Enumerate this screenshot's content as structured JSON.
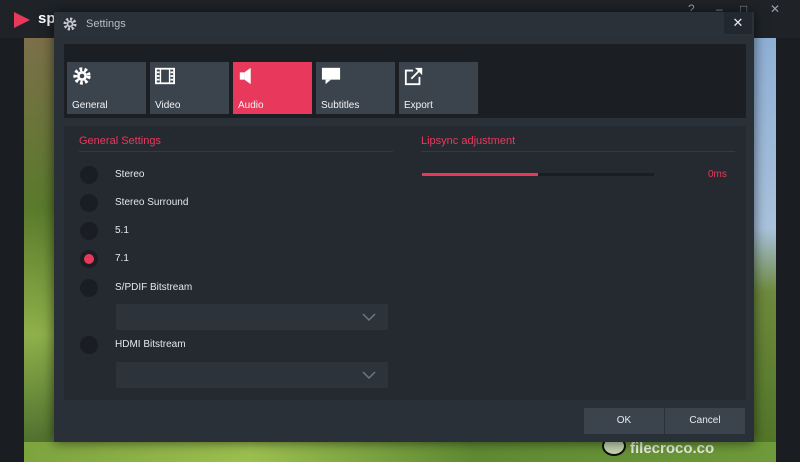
{
  "app": {
    "name": "sp"
  },
  "dialog": {
    "title": "Settings",
    "close_symbol": "✕",
    "tabs": [
      {
        "label": "General",
        "icon": "gear-icon"
      },
      {
        "label": "Video",
        "icon": "film-icon"
      },
      {
        "label": "Audio",
        "icon": "speaker-icon"
      },
      {
        "label": "Subtitles",
        "icon": "speech-bubble-icon"
      },
      {
        "label": "Export",
        "icon": "export-icon"
      }
    ],
    "active_tab": "Audio"
  },
  "general_settings": {
    "title": "General Settings",
    "options": [
      {
        "label": "Stereo",
        "checked": false
      },
      {
        "label": "Stereo Surround",
        "checked": false
      },
      {
        "label": "5.1",
        "checked": false
      },
      {
        "label": "7.1",
        "checked": true
      },
      {
        "label": "S/PDIF Bitstream",
        "checked": false
      },
      {
        "label": "HDMI Bitstream",
        "checked": false
      }
    ],
    "spdif_select_value": "",
    "hdmi_select_value": ""
  },
  "lipsync": {
    "title": "Lipsync adjustment",
    "value": "0ms",
    "slider_fraction": 0.5
  },
  "footer": {
    "ok_label": "OK",
    "cancel_label": "Cancel"
  },
  "watermark": {
    "text": "filecroco.co"
  },
  "colors": {
    "accent": "#e8395c",
    "panel": "#2a3037",
    "tab": "#3b434c",
    "content": "#252a30"
  }
}
